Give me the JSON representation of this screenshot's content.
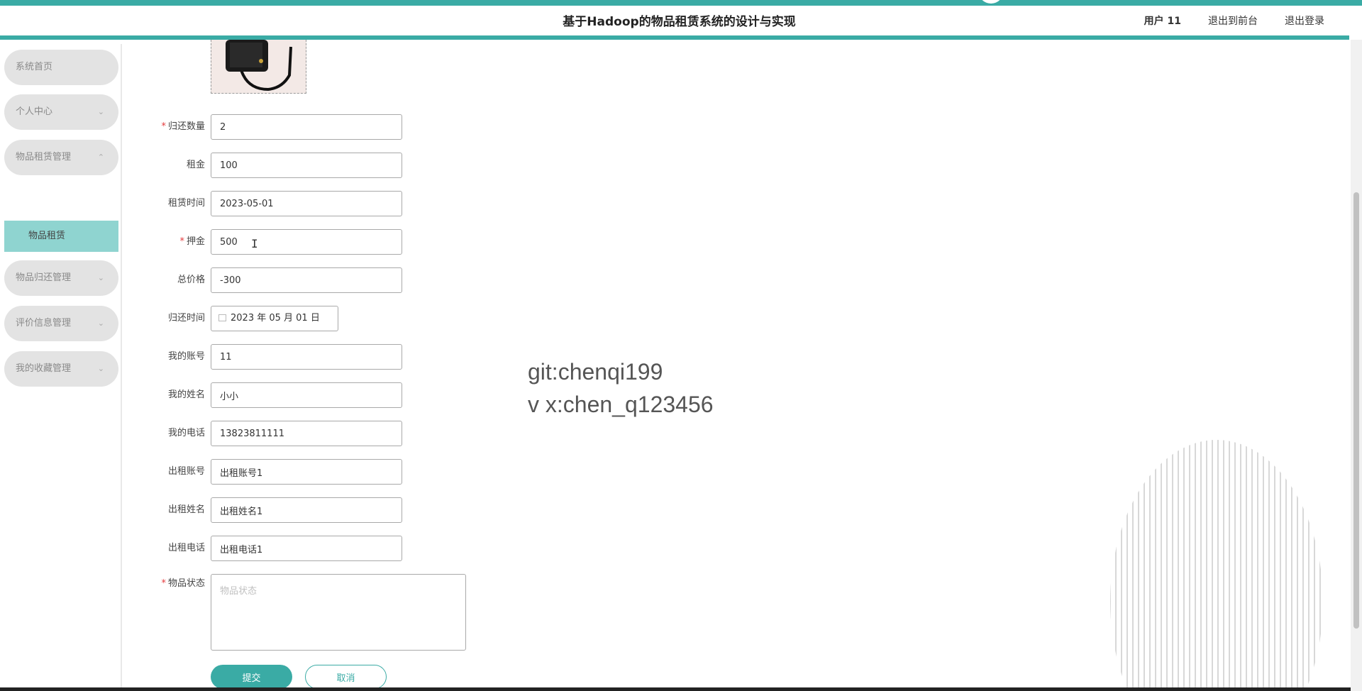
{
  "header": {
    "title": "基于Hadoop的物品租赁系统的设计与实现",
    "user": "用户 11",
    "to_front": "退出到前台",
    "logout": "退出登录"
  },
  "sidebar": {
    "items": [
      {
        "label": "系统首页"
      },
      {
        "label": "个人中心"
      },
      {
        "label": "物品租赁管理"
      },
      {
        "label": "物品归还管理"
      },
      {
        "label": "评价信息管理"
      },
      {
        "label": "我的收藏管理"
      }
    ],
    "sub_active": "物品租赁"
  },
  "form": {
    "fields": [
      {
        "label": "归还数量",
        "value": "2",
        "required": true
      },
      {
        "label": "租金",
        "value": "100",
        "required": false
      },
      {
        "label": "租赁时间",
        "value": "2023-05-01",
        "required": false
      },
      {
        "label": "押金",
        "value": "500",
        "required": true
      },
      {
        "label": "总价格",
        "value": "-300",
        "required": false
      },
      {
        "label": "归还时间",
        "value": "2023 年 05 月 01 日",
        "required": false
      },
      {
        "label": "我的账号",
        "value": "11",
        "required": false
      },
      {
        "label": "我的姓名",
        "value": "小小",
        "required": false
      },
      {
        "label": "我的电话",
        "value": "13823811111",
        "required": false
      },
      {
        "label": "出租账号",
        "value": "出租账号1",
        "required": false
      },
      {
        "label": "出租姓名",
        "value": "出租姓名1",
        "required": false
      },
      {
        "label": "出租电话",
        "value": "出租电话1",
        "required": false
      },
      {
        "label": "物品状态",
        "placeholder": "物品状态",
        "required": true
      }
    ],
    "submit": "提交",
    "cancel": "取消",
    "required_mark": "*"
  },
  "watermark": {
    "line1": "git:chenqi199",
    "line2": "v x:chen_q123456"
  },
  "colors": {
    "accent": "#3aaba5",
    "submenu_active": "#8fd4d0",
    "required": "#e4393c"
  }
}
